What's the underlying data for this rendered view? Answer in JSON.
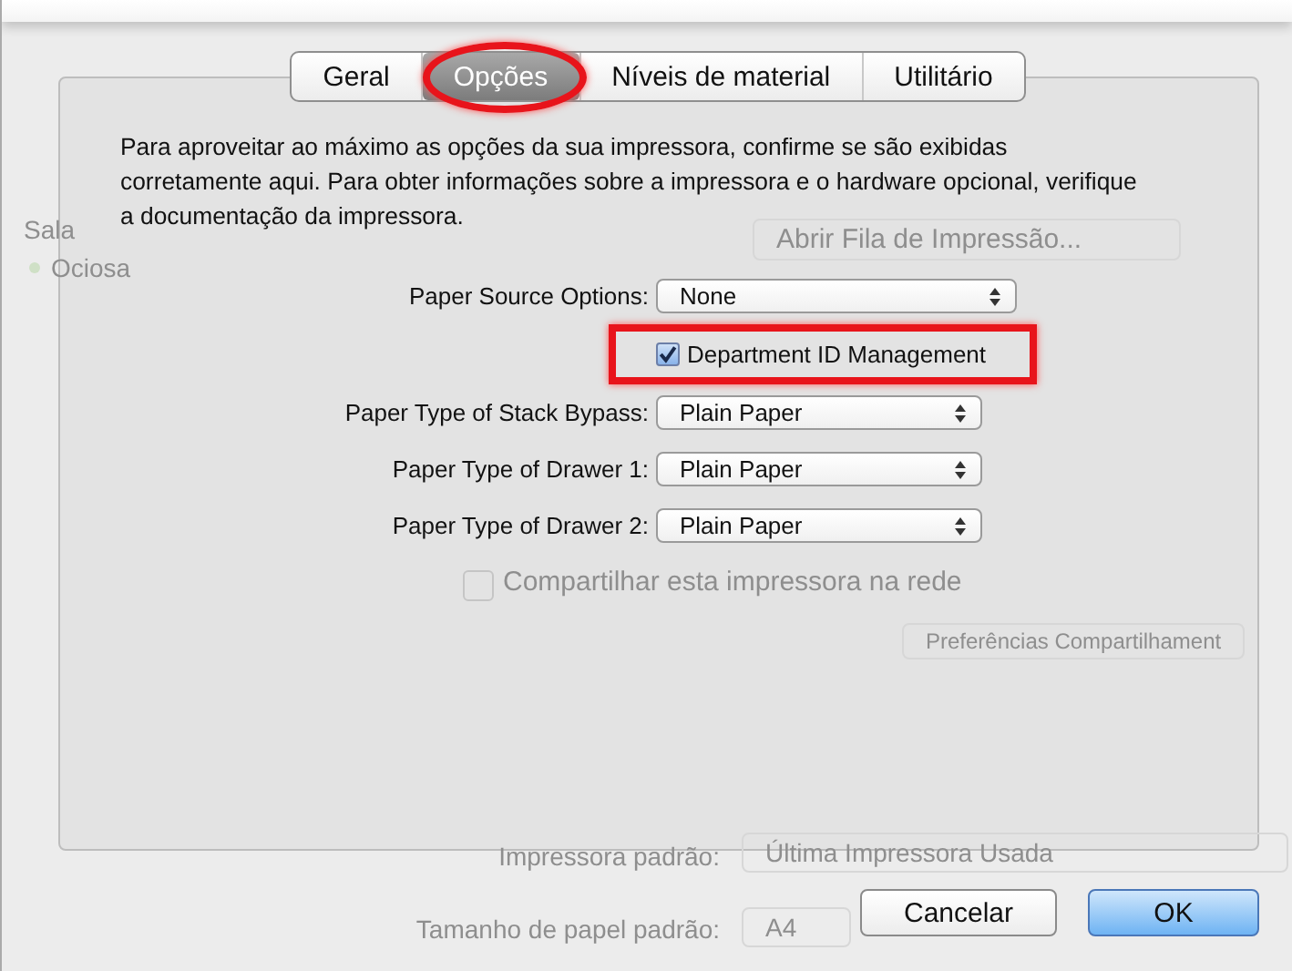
{
  "tabs": [
    {
      "label": "Geral",
      "selected": false,
      "highlighted": false
    },
    {
      "label": "Opções",
      "selected": true,
      "highlighted": true
    },
    {
      "label": "Níveis de material",
      "selected": false,
      "highlighted": false
    },
    {
      "label": "Utilitário",
      "selected": false,
      "highlighted": false
    }
  ],
  "description": "Para aproveitar ao máximo as opções da sua impressora, confirme se são exibidas corretamente aqui. Para obter informações sobre a impressora e o hardware opcional, verifique a documentação da impressora.",
  "options": [
    {
      "kind": "popup",
      "label": "Paper Source Options:",
      "value": "None",
      "wide": true
    },
    {
      "kind": "checkbox",
      "label": "Department ID Management",
      "checked": true,
      "highlighted": true
    },
    {
      "kind": "popup",
      "label": "Paper Type of Stack Bypass:",
      "value": "Plain Paper",
      "wide": false
    },
    {
      "kind": "popup",
      "label": "Paper Type of Drawer 1:",
      "value": "Plain Paper",
      "wide": false
    },
    {
      "kind": "popup",
      "label": "Paper Type of Drawer 2:",
      "value": "Plain Paper",
      "wide": false
    }
  ],
  "buttons": [
    {
      "label": "Cancelar",
      "default": false
    },
    {
      "label": "OK",
      "default": true
    }
  ],
  "background": {
    "sidebar_items": [
      "Sala",
      "Ociosa"
    ],
    "open_queue_button": "Abrir Fila de Impressão...",
    "share_checkbox": "Compartilhar esta impressora na rede",
    "share_checked": false,
    "sharing_button": "Preferências Compartilhament",
    "default_printer_label": "Impressora padrão:",
    "default_printer_value": "Última Impressora Usada",
    "paper_size_label": "Tamanho de papel padrão:",
    "paper_size_value": "A4"
  }
}
